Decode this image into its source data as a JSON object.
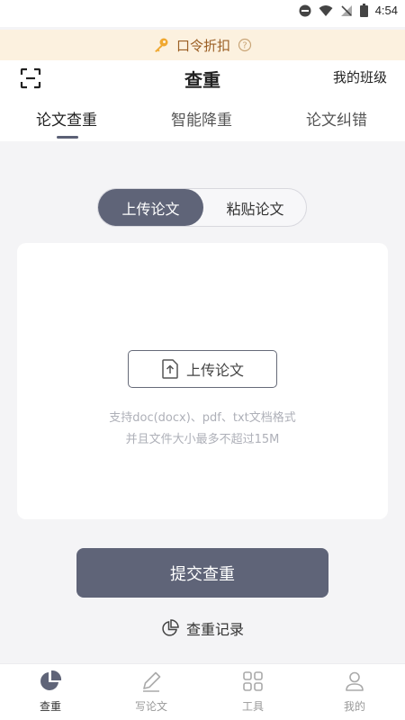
{
  "status_bar": {
    "time": "4:54"
  },
  "promo": {
    "text": "口令折扣"
  },
  "header": {
    "title": "查重",
    "class_link": "我的班级"
  },
  "tabs": [
    {
      "label": "论文查重",
      "active": true
    },
    {
      "label": "智能降重",
      "active": false
    },
    {
      "label": "论文纠错",
      "active": false
    }
  ],
  "segment": {
    "upload_label": "上传论文",
    "paste_label": "粘贴论文",
    "selected": "上传论文"
  },
  "upload": {
    "button_label": "上传论文",
    "hint_line1": "支持doc(docx)、pdf、txt文档格式",
    "hint_line2": "并且文件大小最多不超过15M"
  },
  "submit": {
    "label": "提交查重"
  },
  "history": {
    "label": "查重记录"
  },
  "bottom_nav": [
    {
      "label": "查重",
      "icon": "pie-chart-icon",
      "active": true
    },
    {
      "label": "写论文",
      "icon": "pen-icon",
      "active": false
    },
    {
      "label": "工具",
      "icon": "grid-icon",
      "active": false
    },
    {
      "label": "我的",
      "icon": "user-icon",
      "active": false
    }
  ],
  "colors": {
    "primary": "#5f6478",
    "promo_bg": "#fcf1df",
    "promo_text": "#9b5f24",
    "hint": "#aeb0b8"
  }
}
